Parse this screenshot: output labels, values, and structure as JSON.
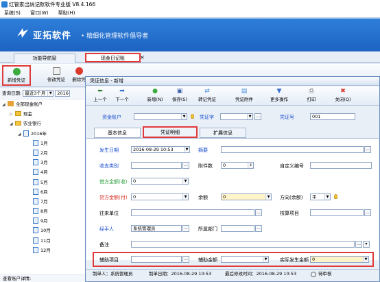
{
  "window": {
    "title": "红管家出纳记账软件专业版 V8.4.166"
  },
  "menu": [
    "系统(S)",
    "窗口(W)",
    "帮助(H)"
  ],
  "banner": {
    "logo": "亚拓软件",
    "slogan": "• 精细化管理软件倡导者"
  },
  "tabs": [
    {
      "label": "功能导航窗"
    },
    {
      "label": "现金日记账"
    }
  ],
  "toolbar": {
    "new_voucher": "新增凭证",
    "modify_voucher": "修改凭证",
    "delete_voucher": "删除凭"
  },
  "query": {
    "label": "查询日期:",
    "range": "最近3个月",
    "date": "2016-0"
  },
  "tree": {
    "root": "全部现金账户",
    "cash": "现金",
    "bank": "农业银行",
    "year": "2016年",
    "months": [
      "1月",
      "2月",
      "3月",
      "4月",
      "5月",
      "6月",
      "7月",
      "8月",
      "9月",
      "10月",
      "11月",
      "12月"
    ]
  },
  "bottom_left": "查看账户详情:",
  "dialog": {
    "title": "凭证信息 - 新增",
    "buttons": {
      "prev": "上一个",
      "next": "下一个",
      "add": "新增(N)",
      "save": "保存(S)",
      "transfer": "转记凭证",
      "attach": "凭证附件",
      "more": "更多操作",
      "print": "打印",
      "close": "关闭(Q)"
    },
    "header": {
      "fund_account": "资金账户",
      "voucher_type": "凭证字",
      "voucher_no_label": "凭证号",
      "voucher_no": "001"
    },
    "tabs": {
      "basic": "基本信息",
      "detail": "凭证明细",
      "ext": "扩展信息"
    },
    "fields": {
      "date_label": "发生日期",
      "date_value": "2016-08-29 10:53",
      "summary": "摘要",
      "category": "收支类别",
      "attachments": "附件数",
      "attachments_value": "0",
      "custom_no": "自定义编号",
      "debit": "借方金额(收)",
      "debit_value": "0",
      "credit": "贷方金额(付)",
      "credit_value": "0",
      "balance": "余额",
      "balance_value": "0",
      "direction": "方向(余额)",
      "direction_value": "平",
      "counterparty": "往来单位",
      "check_item": "核算项目",
      "handler": "经手人",
      "handler_value": "系统管理员",
      "department": "所属部门",
      "remark": "备注",
      "aux_item": "辅助项目",
      "aux_amount": "辅助金额",
      "actual_amount": "实际发生金额",
      "actual_value": "0"
    },
    "status": {
      "maker": "制单人：系统管理员",
      "make_date": "制单日期：2016-08-29 10:53",
      "modify_date": "最后修改时间：2016-08-29 10:53",
      "audit": "待审核"
    }
  }
}
